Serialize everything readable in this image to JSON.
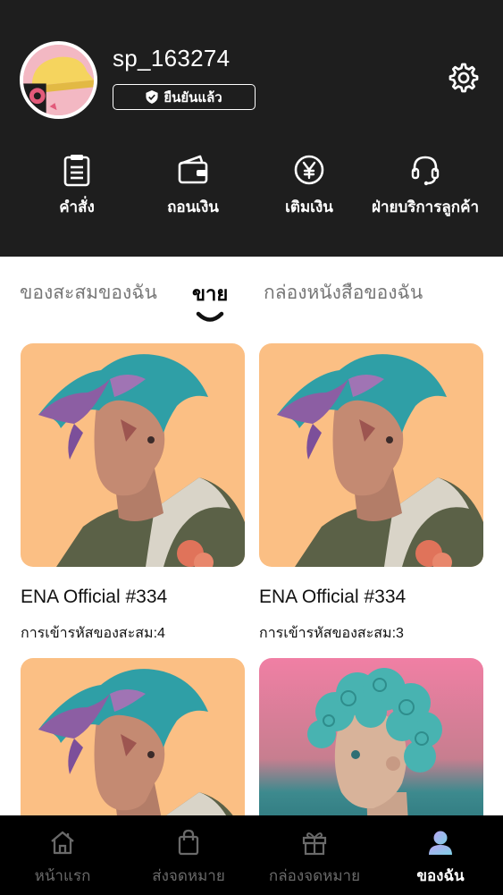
{
  "profile": {
    "username": "sp_163274",
    "verified_label": "ยืนยันแล้ว"
  },
  "quick_actions": [
    {
      "label": "คำสั่ง",
      "icon": "clipboard-icon"
    },
    {
      "label": "ถอนเงิน",
      "icon": "wallet-icon"
    },
    {
      "label": "เติมเงิน",
      "icon": "yen-coin-icon"
    },
    {
      "label": "ฝ่ายบริการลูกค้า",
      "icon": "headset-icon"
    }
  ],
  "tabs": [
    {
      "label": "ของสะสมของฉัน",
      "active": false
    },
    {
      "label": "ขาย",
      "active": true
    },
    {
      "label": "กล่องหนังสือของฉัน",
      "active": false
    }
  ],
  "items": [
    {
      "title": "ENA Official #334",
      "codes": "การเข้ารหัสของสะสม:4",
      "art": "teal-mohawk-portrait"
    },
    {
      "title": "ENA Official #334",
      "codes": "การเข้ารหัสของสะสม:3",
      "art": "teal-mohawk-portrait"
    },
    {
      "title": "",
      "codes": "",
      "art": "teal-mohawk-portrait"
    },
    {
      "title": "",
      "codes": "",
      "art": "teal-curly-hair-portrait"
    }
  ],
  "bottom_nav": [
    {
      "label": "หน้าแรก",
      "icon": "home-icon",
      "active": false
    },
    {
      "label": "ส่งจดหมาย",
      "icon": "shopping-bag-icon",
      "active": false
    },
    {
      "label": "กล่องจดหมาย",
      "icon": "gift-icon",
      "active": false
    },
    {
      "label": "ของฉัน",
      "icon": "user-avatar-icon",
      "active": true
    }
  ],
  "colors": {
    "header_bg": "#1e1e1e",
    "art_bg_orange": "#fbbf84",
    "art_hair_teal": "#2f9fa6",
    "nav_bg": "#000000"
  }
}
